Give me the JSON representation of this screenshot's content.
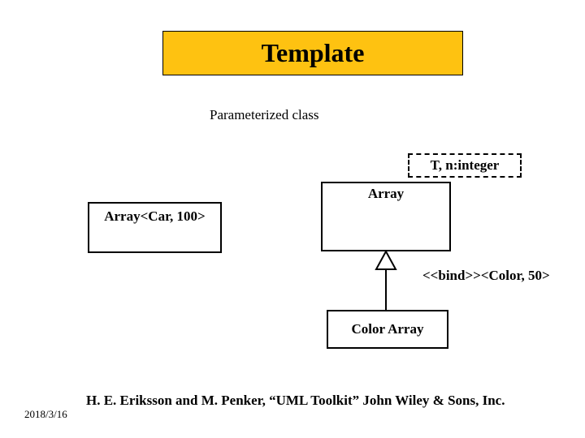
{
  "title": "Template",
  "subtitle": "Parameterized class",
  "boxes": {
    "left": "Array<Car, 100>",
    "template_param": "T, n:integer",
    "array": "Array",
    "color_array": "Color Array"
  },
  "bind_label": "<<bind>><Color, 50>",
  "citation": "H. E. Eriksson and M. Penker, “UML Toolkit” John Wiley & Sons, Inc.",
  "date": "2018/3/16"
}
